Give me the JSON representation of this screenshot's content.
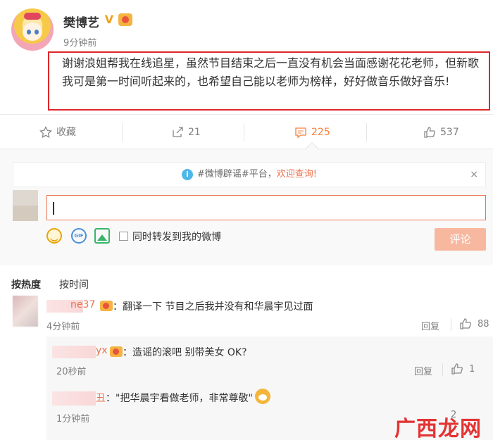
{
  "post": {
    "username": "樊博艺",
    "verified_mark": "V",
    "time": "9分钟前",
    "text": "谢谢浪姐帮我在线追星，虽然节目结束之后一直没有机会当面感谢花花老师，但新歌我可是第一时间听起来的，也希望自己能以老师为榜样，好好做音乐做好音乐!",
    "highlight_color": "#e0262a"
  },
  "actions": {
    "favorite_label": "收藏",
    "repost_count": "21",
    "comment_count": "225",
    "like_count": "537",
    "icons": [
      "star-icon",
      "share-icon",
      "comment-icon",
      "thumbs-up-icon"
    ]
  },
  "composer": {
    "notice_prefix": "#微博辟谣#平台，",
    "notice_link": "欢迎查询!",
    "close": "×",
    "checkbox_label": "同时转发到我的微博",
    "submit_label": "评论",
    "gif_label": "GIF",
    "accent_color": "#eb7350"
  },
  "sort": {
    "hot": "按热度",
    "time": "按时间"
  },
  "comments": [
    {
      "name_visible": "ne37",
      "text": "：翻译一下 节目之后我并没有和华晨宇见过面",
      "time": "4分钟前",
      "reply_label": "回复",
      "likes": "88"
    },
    {
      "name_visible": "yx",
      "text": "：造谣的滚吧 别带美女  OK?",
      "time": "20秒前",
      "reply_label": "回复",
      "likes": "1"
    },
    {
      "name_visible": "丑",
      "text": "：\"把华晨宇看做老师，非常尊敬\"",
      "time": "1分钟前",
      "likes": "2"
    }
  ],
  "watermark": "广西龙网"
}
